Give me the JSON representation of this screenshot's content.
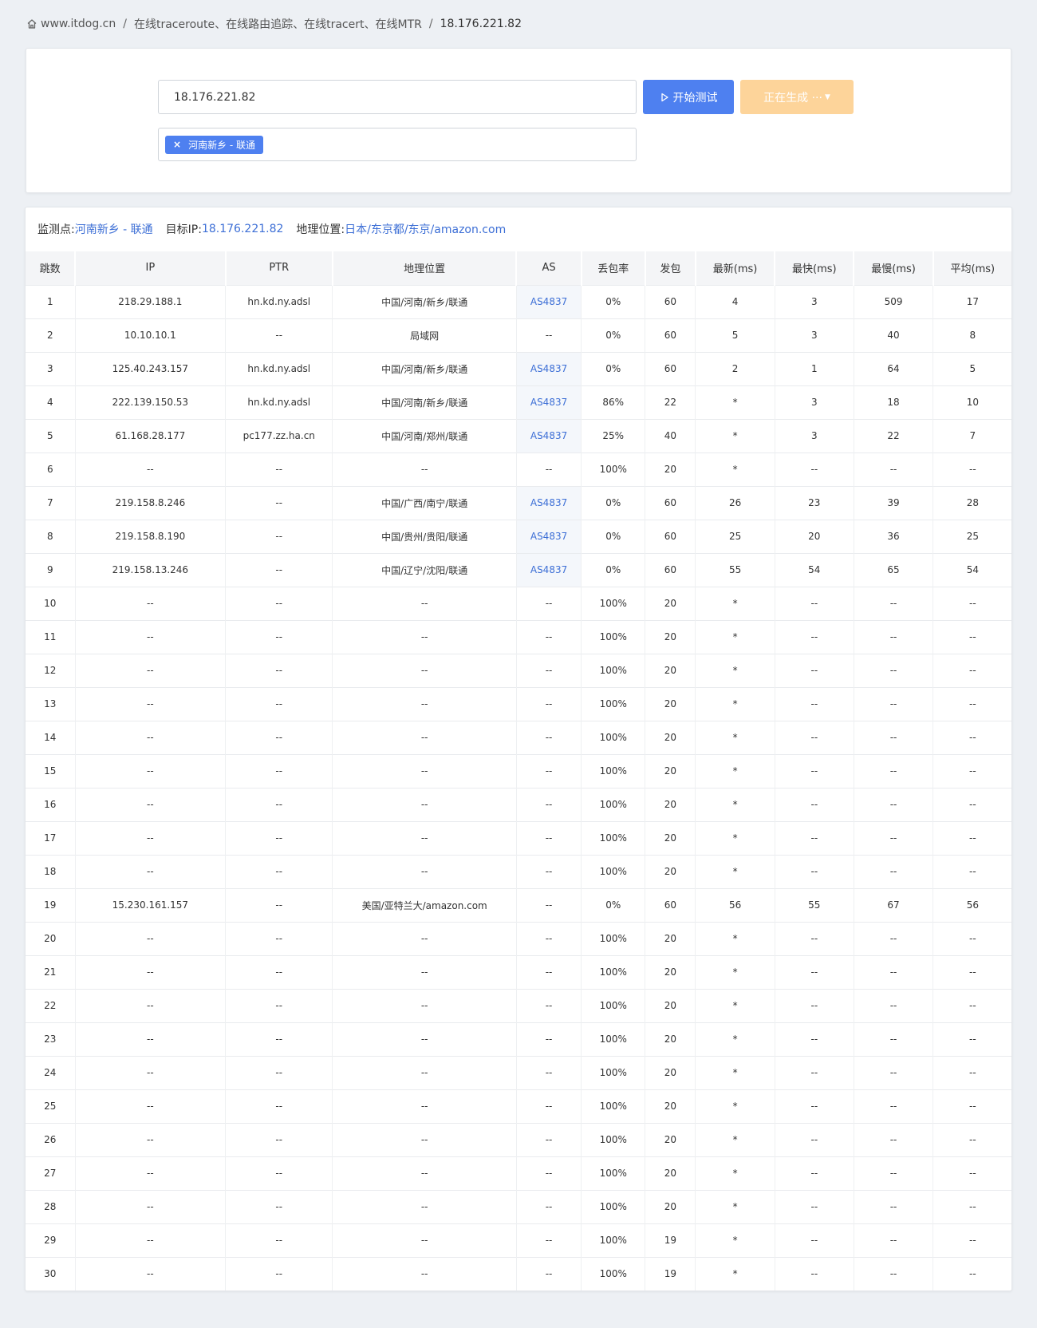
{
  "breadcrumb": {
    "home_label": "www.itdog.cn",
    "section_label": "在线traceroute、在线路由追踪、在线tracert、在线MTR",
    "current_label": "18.176.221.82",
    "separator": "/"
  },
  "search": {
    "ip_value": "18.176.221.82",
    "start_button_label": "开始测试",
    "generating_button_label": "正在生成 ···",
    "selected_node_tag": "河南新乡 - 联通"
  },
  "summary": {
    "monitor_label": "监测点:",
    "monitor_value": "河南新乡 - 联通",
    "target_label": "目标IP:",
    "target_value": "18.176.221.82",
    "location_label": "地理位置:",
    "location_value": "日本/东京都/东京/amazon.com"
  },
  "table": {
    "headers": {
      "hop": "跳数",
      "ip": "IP",
      "ptr": "PTR",
      "geo": "地理位置",
      "as": "AS",
      "loss": "丢包率",
      "sent": "发包",
      "last": "最新(ms)",
      "best": "最快(ms)",
      "worst": "最慢(ms)",
      "avg": "平均(ms)"
    },
    "rows": [
      [
        "1",
        "218.29.188.1",
        "hn.kd.ny.adsl",
        "中国/河南/新乡/联通",
        "AS4837",
        "0%",
        "60",
        "4",
        "3",
        "509",
        "17"
      ],
      [
        "2",
        "10.10.10.1",
        "--",
        "局域网",
        "--",
        "0%",
        "60",
        "5",
        "3",
        "40",
        "8"
      ],
      [
        "3",
        "125.40.243.157",
        "hn.kd.ny.adsl",
        "中国/河南/新乡/联通",
        "AS4837",
        "0%",
        "60",
        "2",
        "1",
        "64",
        "5"
      ],
      [
        "4",
        "222.139.150.53",
        "hn.kd.ny.adsl",
        "中国/河南/新乡/联通",
        "AS4837",
        "86%",
        "22",
        "*",
        "3",
        "18",
        "10"
      ],
      [
        "5",
        "61.168.28.177",
        "pc177.zz.ha.cn",
        "中国/河南/郑州/联通",
        "AS4837",
        "25%",
        "40",
        "*",
        "3",
        "22",
        "7"
      ],
      [
        "6",
        "--",
        "--",
        "--",
        "--",
        "100%",
        "20",
        "*",
        "--",
        "--",
        "--"
      ],
      [
        "7",
        "219.158.8.246",
        "--",
        "中国/广西/南宁/联通",
        "AS4837",
        "0%",
        "60",
        "26",
        "23",
        "39",
        "28"
      ],
      [
        "8",
        "219.158.8.190",
        "--",
        "中国/贵州/贵阳/联通",
        "AS4837",
        "0%",
        "60",
        "25",
        "20",
        "36",
        "25"
      ],
      [
        "9",
        "219.158.13.246",
        "--",
        "中国/辽宁/沈阳/联通",
        "AS4837",
        "0%",
        "60",
        "55",
        "54",
        "65",
        "54"
      ],
      [
        "10",
        "--",
        "--",
        "--",
        "--",
        "100%",
        "20",
        "*",
        "--",
        "--",
        "--"
      ],
      [
        "11",
        "--",
        "--",
        "--",
        "--",
        "100%",
        "20",
        "*",
        "--",
        "--",
        "--"
      ],
      [
        "12",
        "--",
        "--",
        "--",
        "--",
        "100%",
        "20",
        "*",
        "--",
        "--",
        "--"
      ],
      [
        "13",
        "--",
        "--",
        "--",
        "--",
        "100%",
        "20",
        "*",
        "--",
        "--",
        "--"
      ],
      [
        "14",
        "--",
        "--",
        "--",
        "--",
        "100%",
        "20",
        "*",
        "--",
        "--",
        "--"
      ],
      [
        "15",
        "--",
        "--",
        "--",
        "--",
        "100%",
        "20",
        "*",
        "--",
        "--",
        "--"
      ],
      [
        "16",
        "--",
        "--",
        "--",
        "--",
        "100%",
        "20",
        "*",
        "--",
        "--",
        "--"
      ],
      [
        "17",
        "--",
        "--",
        "--",
        "--",
        "100%",
        "20",
        "*",
        "--",
        "--",
        "--"
      ],
      [
        "18",
        "--",
        "--",
        "--",
        "--",
        "100%",
        "20",
        "*",
        "--",
        "--",
        "--"
      ],
      [
        "19",
        "15.230.161.157",
        "--",
        "美国/亚特兰大/amazon.com",
        "--",
        "0%",
        "60",
        "56",
        "55",
        "67",
        "56"
      ],
      [
        "20",
        "--",
        "--",
        "--",
        "--",
        "100%",
        "20",
        "*",
        "--",
        "--",
        "--"
      ],
      [
        "21",
        "--",
        "--",
        "--",
        "--",
        "100%",
        "20",
        "*",
        "--",
        "--",
        "--"
      ],
      [
        "22",
        "--",
        "--",
        "--",
        "--",
        "100%",
        "20",
        "*",
        "--",
        "--",
        "--"
      ],
      [
        "23",
        "--",
        "--",
        "--",
        "--",
        "100%",
        "20",
        "*",
        "--",
        "--",
        "--"
      ],
      [
        "24",
        "--",
        "--",
        "--",
        "--",
        "100%",
        "20",
        "*",
        "--",
        "--",
        "--"
      ],
      [
        "25",
        "--",
        "--",
        "--",
        "--",
        "100%",
        "20",
        "*",
        "--",
        "--",
        "--"
      ],
      [
        "26",
        "--",
        "--",
        "--",
        "--",
        "100%",
        "20",
        "*",
        "--",
        "--",
        "--"
      ],
      [
        "27",
        "--",
        "--",
        "--",
        "--",
        "100%",
        "20",
        "*",
        "--",
        "--",
        "--"
      ],
      [
        "28",
        "--",
        "--",
        "--",
        "--",
        "100%",
        "20",
        "*",
        "--",
        "--",
        "--"
      ],
      [
        "29",
        "--",
        "--",
        "--",
        "--",
        "100%",
        "19",
        "*",
        "--",
        "--",
        "--"
      ],
      [
        "30",
        "--",
        "--",
        "--",
        "--",
        "100%",
        "19",
        "*",
        "--",
        "--",
        "--"
      ]
    ]
  },
  "colors": {
    "accent": "#4e80f0",
    "link": "#3d6fd6",
    "generating": "#fdd49a",
    "background": "#edf0f4"
  },
  "icons": {
    "home": "home-icon",
    "play": "play-icon",
    "close": "close-icon",
    "caret": "caret-down-icon"
  }
}
